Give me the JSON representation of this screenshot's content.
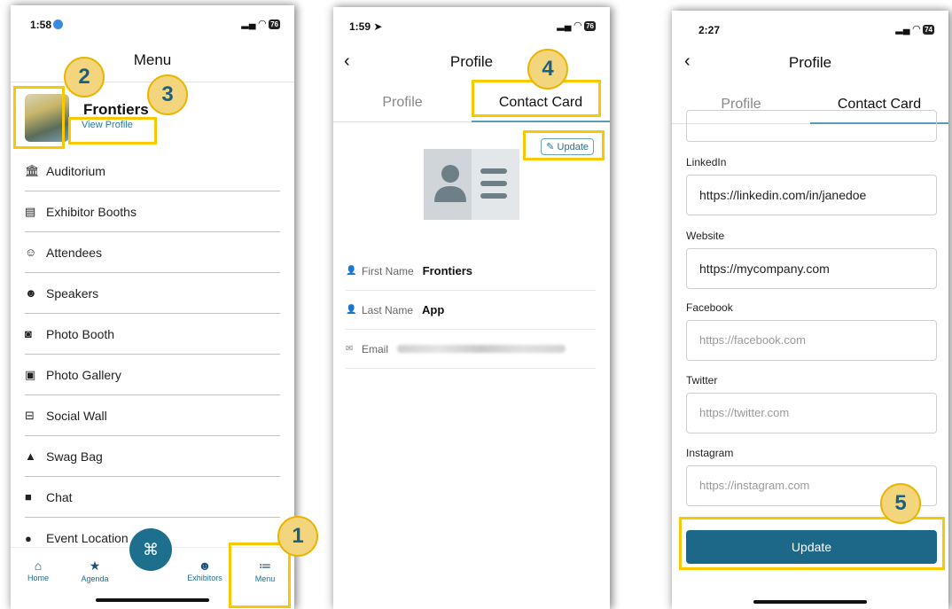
{
  "phones": {
    "menu": {
      "time": "1:58",
      "battery": "76",
      "title": "Menu",
      "profile_name": "Frontiers",
      "view_profile": "View Profile",
      "items": [
        {
          "icon": "auditorium-icon",
          "glyph": "🏛",
          "label": "Auditorium"
        },
        {
          "icon": "exhibitor-booths-icon",
          "glyph": "▤",
          "label": "Exhibitor Booths"
        },
        {
          "icon": "attendees-icon",
          "glyph": "☺",
          "label": "Attendees"
        },
        {
          "icon": "speakers-icon",
          "glyph": "☻",
          "label": "Speakers"
        },
        {
          "icon": "camera-icon",
          "glyph": "◙",
          "label": "Photo Booth"
        },
        {
          "icon": "photo-gallery-icon",
          "glyph": "▣",
          "label": "Photo Gallery"
        },
        {
          "icon": "social-wall-icon",
          "glyph": "⊟",
          "label": "Social Wall"
        },
        {
          "icon": "swag-bag-icon",
          "glyph": "▲",
          "label": "Swag Bag"
        },
        {
          "icon": "chat-icon",
          "glyph": "■",
          "label": "Chat"
        },
        {
          "icon": "location-pin-icon",
          "glyph": "●",
          "label": "Event Location"
        }
      ],
      "tabbar": {
        "home": "Home",
        "agenda": "Agenda",
        "exhibitors": "Exhibitors",
        "menu": "Menu"
      }
    },
    "contact": {
      "time": "1:59",
      "battery": "76",
      "title": "Profile",
      "tab_profile": "Profile",
      "tab_contact": "Contact Card",
      "update_chip": "Update",
      "fields": {
        "first_name_label": "First Name",
        "first_name_value": "Frontiers",
        "last_name_label": "Last Name",
        "last_name_value": "App",
        "email_label": "Email"
      }
    },
    "form": {
      "time": "2:27",
      "battery": "74",
      "title": "Profile",
      "tab_profile": "Profile",
      "tab_contact": "Contact Card",
      "linkedin_label": "LinkedIn",
      "linkedin_value": "https://linkedin.com/in/janedoe",
      "website_label": "Website",
      "website_value": "https://mycompany.com",
      "facebook_label": "Facebook",
      "facebook_placeholder": "https://facebook.com",
      "twitter_label": "Twitter",
      "twitter_placeholder": "https://twitter.com",
      "instagram_label": "Instagram",
      "instagram_placeholder": "https://instagram.com",
      "update_button": "Update"
    }
  },
  "badges": [
    "1",
    "2",
    "3",
    "4",
    "5"
  ],
  "colors": {
    "highlight": "#f6c900",
    "badge_fill": "#f3d57d",
    "badge_text": "#1b5f83",
    "brand": "#1d6889",
    "link": "#2a7aa3"
  }
}
